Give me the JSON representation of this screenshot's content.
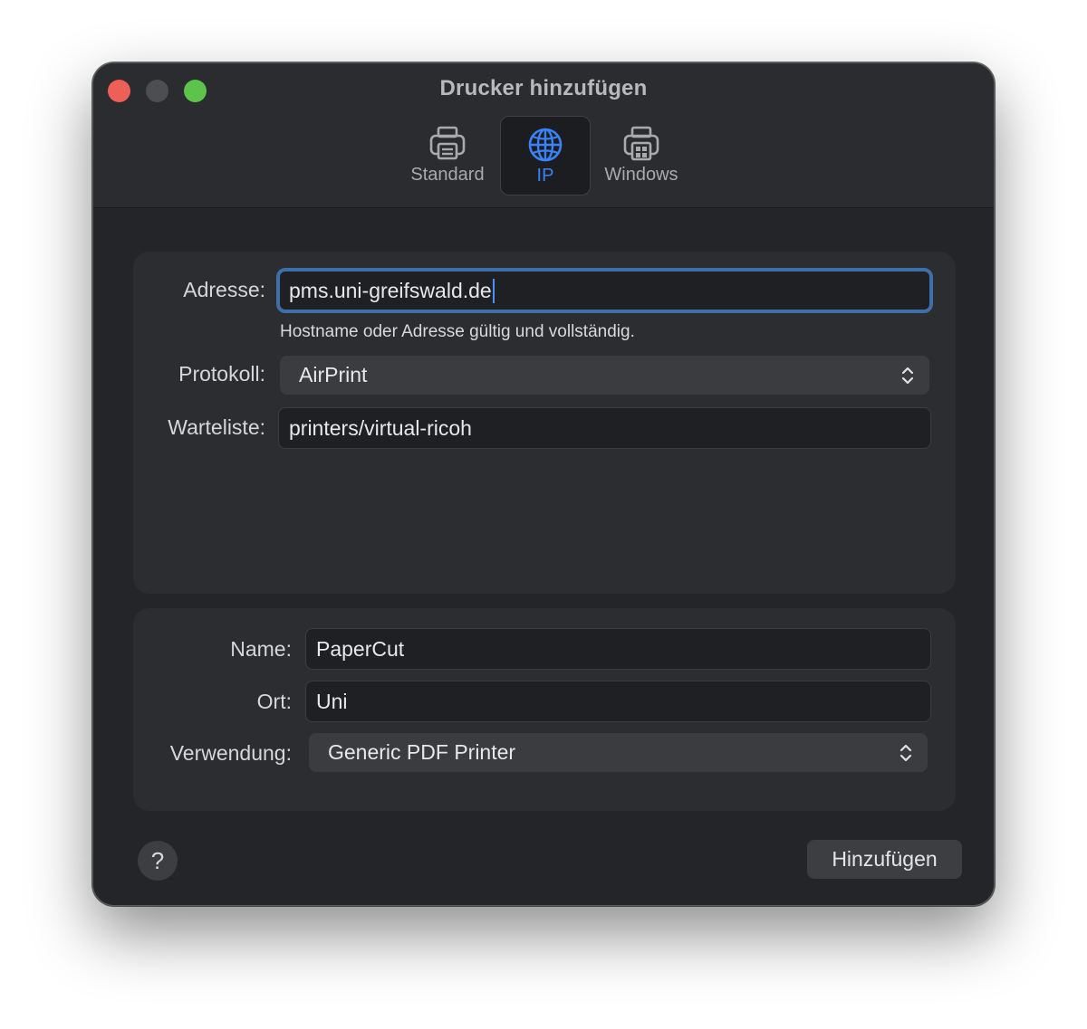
{
  "window": {
    "title": "Drucker hinzufügen"
  },
  "toolbar": {
    "tabs": [
      {
        "label": "Standard",
        "icon": "printer-icon",
        "selected": false
      },
      {
        "label": "IP",
        "icon": "globe-icon",
        "selected": true
      },
      {
        "label": "Windows",
        "icon": "windows-printer-icon",
        "selected": false
      }
    ]
  },
  "connection": {
    "address_label": "Adresse:",
    "address_value": "pms.uni-greifswald.de",
    "address_hint": "Hostname oder Adresse gültig und vollständig.",
    "protocol_label": "Protokoll:",
    "protocol_value": "AirPrint",
    "queue_label": "Warteliste:",
    "queue_value": "printers/virtual-ricoh"
  },
  "details": {
    "name_label": "Name:",
    "name_value": "PaperCut",
    "location_label": "Ort:",
    "location_value": "Uni",
    "use_label": "Verwendung:",
    "use_value": "Generic PDF Printer"
  },
  "footer": {
    "help_label": "?",
    "add_label": "Hinzufügen"
  },
  "colors": {
    "accent": "#3a82f7",
    "close": "#ee5f57",
    "maximize": "#5cc44a"
  }
}
